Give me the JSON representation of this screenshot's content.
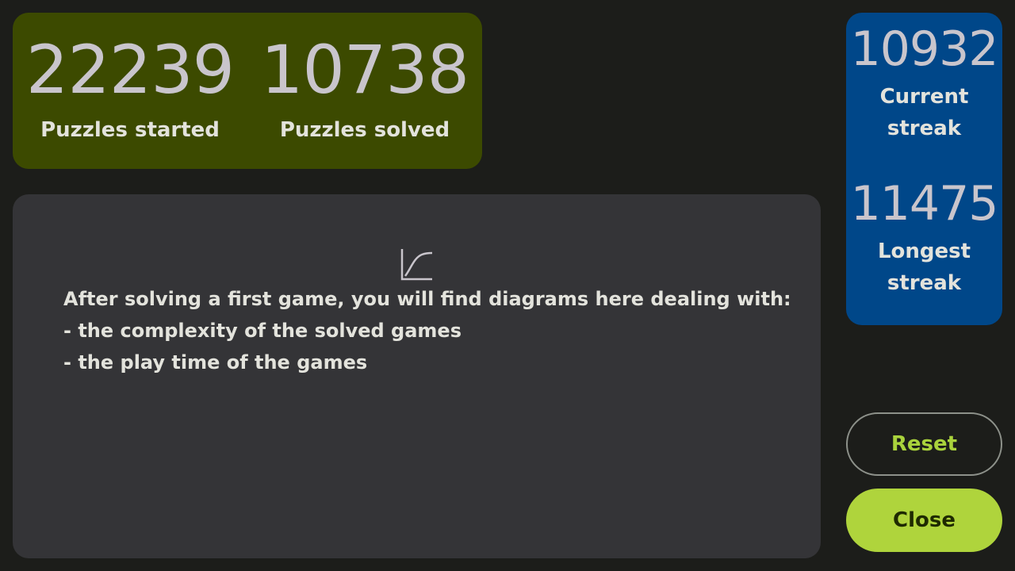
{
  "stats": {
    "started": {
      "value": "22239",
      "label": "Puzzles started"
    },
    "solved": {
      "value": "10738",
      "label": "Puzzles solved"
    }
  },
  "streaks": {
    "current": {
      "value": "10932",
      "label": "Current streak"
    },
    "longest": {
      "value": "11475",
      "label": "Longest streak"
    }
  },
  "info": {
    "icon": "chart-curve-icon",
    "lines": [
      "After solving a first game, you will find diagrams here dealing with:",
      "- the complexity of the solved games",
      "- the play time of the games"
    ]
  },
  "buttons": {
    "reset": "Reset",
    "close": "Close"
  },
  "colors": {
    "background": "#1c1d1a",
    "stats_card": "#3c4a00",
    "streak_card": "#004789",
    "info_panel": "#343437",
    "accent": "#afd43c"
  }
}
